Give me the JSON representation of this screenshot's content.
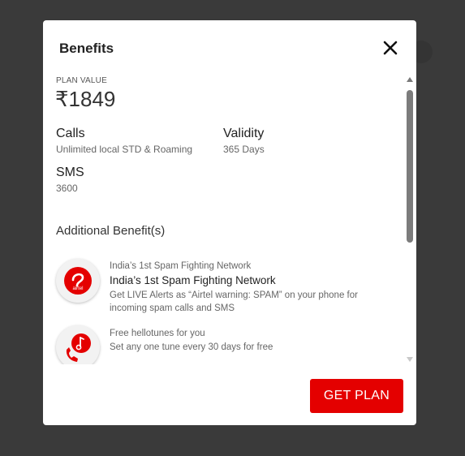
{
  "modal": {
    "title": "Benefits",
    "close_icon": "close-icon",
    "plan_value_label": "PLAN VALUE",
    "plan_value": "₹1849",
    "features": {
      "calls_title": "Calls",
      "calls_value": "Unlimited local STD & Roaming",
      "validity_title": "Validity",
      "validity_value": "365 Days",
      "sms_title": "SMS",
      "sms_value": "3600"
    },
    "additional_title": "Additional Benefit(s)",
    "benefits": [
      {
        "icon": "airtel-logo-icon",
        "small": "India’s 1st Spam Fighting Network",
        "title": "India’s 1st Spam Fighting Network",
        "desc": "Get LIVE Alerts as “Airtel warning: SPAM” on your phone for incoming spam calls and SMS"
      },
      {
        "icon": "hellotunes-icon",
        "small": "Free hellotunes for you",
        "desc": "Set any one tune every 30 days for free"
      }
    ],
    "cta_label": "GET PLAN"
  },
  "colors": {
    "brand_red": "#e40000",
    "backdrop": "#3a3a3a",
    "modal_bg": "#ffffff"
  }
}
